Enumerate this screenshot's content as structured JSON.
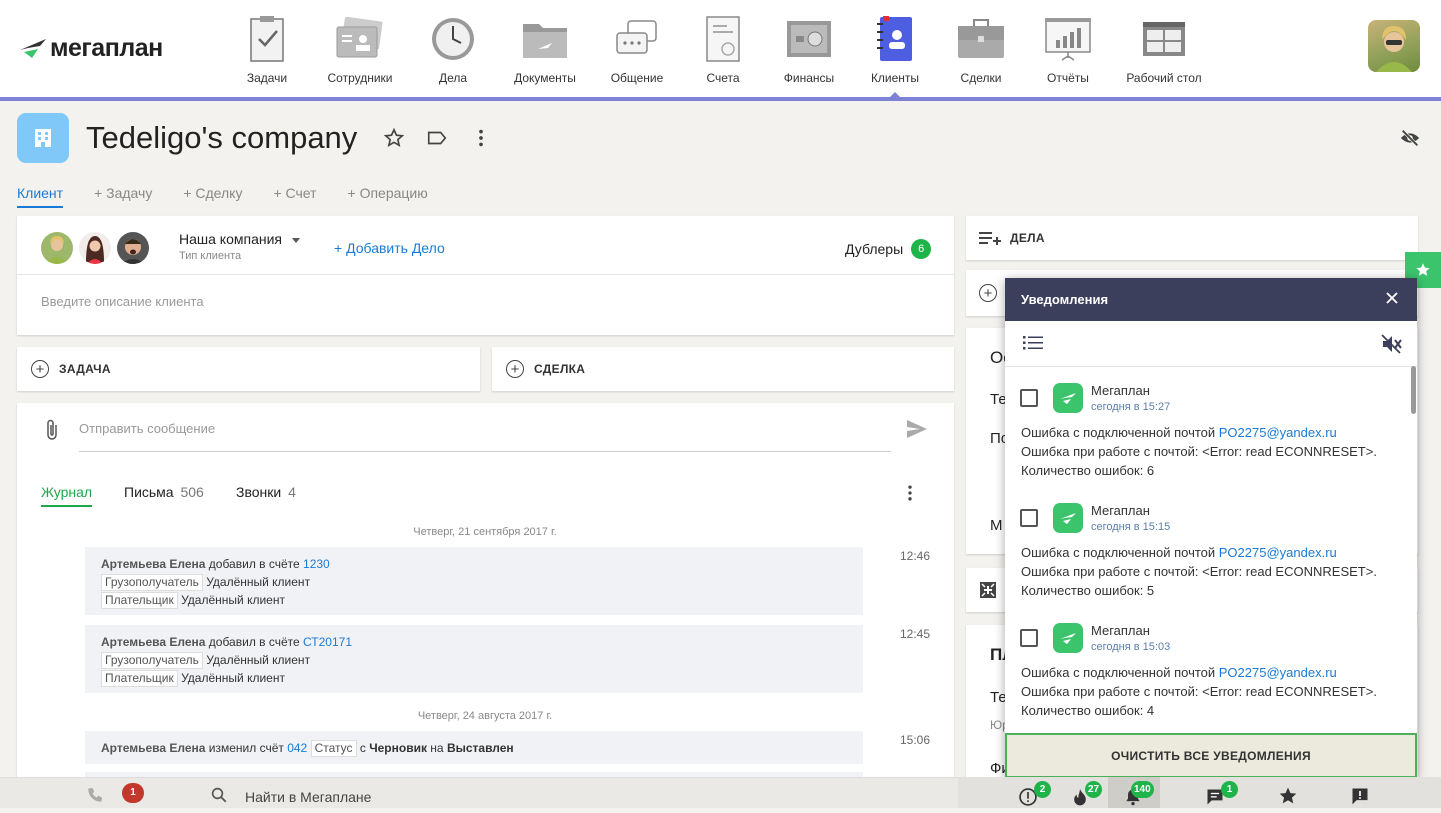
{
  "app": {
    "logo_text": "мегаплан"
  },
  "nav": {
    "items": [
      {
        "label": "Задачи",
        "icon": "tasks-icon"
      },
      {
        "label": "Сотрудники",
        "icon": "employees-icon"
      },
      {
        "label": "Дела",
        "icon": "clock-icon"
      },
      {
        "label": "Документы",
        "icon": "folder-icon"
      },
      {
        "label": "Общение",
        "icon": "chat-icon"
      },
      {
        "label": "Счета",
        "icon": "invoice-icon"
      },
      {
        "label": "Финансы",
        "icon": "safe-icon"
      },
      {
        "label": "Клиенты",
        "icon": "clients-icon"
      },
      {
        "label": "Сделки",
        "icon": "briefcase-icon"
      },
      {
        "label": "Отчёты",
        "icon": "reports-icon"
      },
      {
        "label": "Рабочий стол",
        "icon": "desktop-icon"
      }
    ],
    "active": "Клиенты"
  },
  "page": {
    "title": "Tedeligo's company"
  },
  "tabs": [
    "Клиент",
    "+ Задачу",
    "+ Сделку",
    "+ Счет",
    "+ Операцию"
  ],
  "client": {
    "type_value": "Наша компания",
    "type_label": "Тип клиента",
    "add_deal": "+ Добавить Дело",
    "duplicates_label": "Дублеры",
    "duplicates_count": "6",
    "description_placeholder": "Введите описание клиента"
  },
  "actions": {
    "task": "ЗАДАЧА",
    "deal": "СДЕЛКА"
  },
  "message": {
    "placeholder": "Отправить сообщение"
  },
  "feed_tabs": {
    "journal": "Журнал",
    "letters": "Письма",
    "letters_count": "506",
    "calls": "Звонки",
    "calls_count": "4"
  },
  "feed": {
    "date1": "Четверг, 21 сентября 2017 г.",
    "date2": "Четверг, 24 августа 2017 г.",
    "items": [
      {
        "who": "Артемьева Елена",
        "action": " добавил в счёте ",
        "link": "1230",
        "time": "12:46",
        "r1_tag": "Грузополучатель",
        "r1_val": "Удалённый клиент",
        "r2_tag": "Плательщик",
        "r2_val": "Удалённый клиент"
      },
      {
        "who": "Артемьева Елена",
        "action": " добавил в счёте ",
        "link": "СТ20171",
        "time": "12:45",
        "r1_tag": "Грузополучатель",
        "r1_val": "Удалённый клиент",
        "r2_tag": "Плательщик",
        "r2_val": "Удалённый клиент"
      },
      {
        "who": "Артемьева Елена",
        "action": " изменил счёт ",
        "link": "042",
        "tag": "Статус",
        "from_word": " с ",
        "from": "Черновик",
        "to_word": " на ",
        "to": "Выставлен",
        "time": "15:06"
      }
    ]
  },
  "right": {
    "deals_header": "ДЕЛА",
    "letters": [
      "Ос",
      "Те",
      "По",
      "М",
      "Пл",
      "Те",
      "Юр",
      "Фи"
    ]
  },
  "notifications": {
    "title": "Уведомления",
    "items": [
      {
        "from": "Мегаплан",
        "time": "сегодня в 15:27",
        "l1": "Ошибка с подключенной почтой ",
        "email": "PO2275@yandex.ru",
        "l2": "Ошибка при работе с почтой: <Error: read ECONNRESET>.",
        "l3": "Количество ошибок: 6"
      },
      {
        "from": "Мегаплан",
        "time": "сегодня в 15:15",
        "l1": "Ошибка с подключенной почтой ",
        "email": "PO2275@yandex.ru",
        "l2": "Ошибка при работе с почтой: <Error: read ECONNRESET>.",
        "l3": "Количество ошибок: 5"
      },
      {
        "from": "Мегаплан",
        "time": "сегодня в 15:03",
        "l1": "Ошибка с подключенной почтой ",
        "email": "PO2275@yandex.ru",
        "l2": "Ошибка при работе с почтой: <Error: read ECONNRESET>.",
        "l3": "Количество ошибок: 4"
      }
    ],
    "clear_button": "ОЧИСТИТЬ ВСЕ УВЕДОМЛЕНИЯ"
  },
  "bottom": {
    "calls_badge": "1",
    "search_placeholder": "Найти в Мегаплане",
    "alerts_badge": "2",
    "hot_badge": "27",
    "bell_badge": "140",
    "messages_badge": "1"
  },
  "colors": {
    "accent": "#7d82d4",
    "link": "#1a7bd6",
    "green": "#1fb44a",
    "notif_header": "#3c3f5c"
  }
}
